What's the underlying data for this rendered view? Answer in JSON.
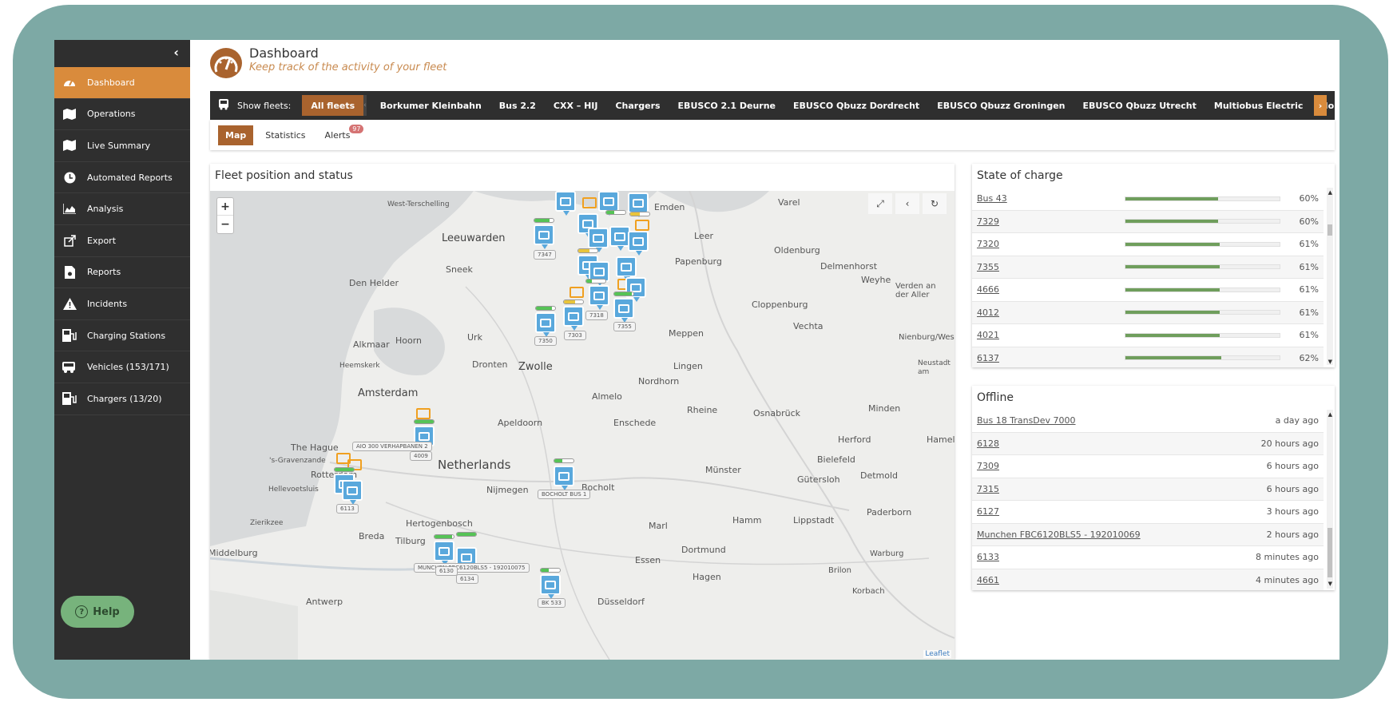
{
  "sidebar": {
    "items": [
      {
        "label": "Dashboard",
        "icon": "speedometer-icon"
      },
      {
        "label": "Operations",
        "icon": "map-icon"
      },
      {
        "label": "Live Summary",
        "icon": "map-icon"
      },
      {
        "label": "Automated Reports",
        "icon": "clock-icon"
      },
      {
        "label": "Analysis",
        "icon": "area-chart-icon"
      },
      {
        "label": "Export",
        "icon": "export-icon"
      },
      {
        "label": "Reports",
        "icon": "report-file-icon"
      },
      {
        "label": "Incidents",
        "icon": "warning-icon"
      },
      {
        "label": "Charging Stations",
        "icon": "charging-station-icon"
      },
      {
        "label": "Vehicles (153/171)",
        "icon": "bus-icon"
      },
      {
        "label": "Chargers (13/20)",
        "icon": "charger-icon"
      }
    ],
    "help_label": "Help"
  },
  "header": {
    "title": "Dashboard",
    "subtitle": "Keep track of the activity of your fleet"
  },
  "fleets": {
    "show_label": "Show fleets:",
    "items": [
      "All fleets",
      "Borkumer Kleinbahn",
      "Bus 2.2",
      "CXX – HIJ",
      "Chargers",
      "EBUSCO 2.1 Deurne",
      "EBUSCO Qbuzz Dordrecht",
      "EBUSCO Qbuzz Groningen",
      "EBUSCO Qbuzz Utrecht",
      "Multiobus Electric",
      "Norgesbuss Norway"
    ]
  },
  "tabs": {
    "map": "Map",
    "statistics": "Statistics",
    "alerts": "Alerts",
    "alerts_count": "97"
  },
  "map_panel": {
    "title": "Fleet position and status",
    "zoom_in": "+",
    "zoom_out": "−",
    "attribution": "Leaflet",
    "cities": [
      "West-Terschelling",
      "Leeuwarden",
      "Emden",
      "Varel",
      "Leer",
      "Oldenburg",
      "Sneek",
      "Papenburg",
      "Delmenhorst",
      "Den Helder",
      "Weyhe",
      "Verden an der Aller",
      "Cloppenburg",
      "Vechta",
      "Meppen",
      "Urk",
      "Alkmaar",
      "Hoorn",
      "Nienburg/Weser",
      "Heemskerk",
      "Dronten",
      "Zwolle",
      "Lingen",
      "Neustadt am Rübenberge",
      "Amsterdam",
      "Nordhorn",
      "Almelo",
      "Rheine",
      "Osnabrück",
      "Minden",
      "Apeldoorn",
      "Enschede",
      "The Hague",
      "Herford",
      "Hameln",
      "'s-Gravenzande",
      "Netherlands",
      "Bielefeld",
      "Rotterdam",
      "Münster",
      "Gütersloh",
      "Detmold",
      "Hellevoetsluis",
      "Nijmegen",
      "Bocholt",
      "Zierikzee",
      "Hertogenbosch",
      "Marl",
      "Hamm",
      "Lippstadt",
      "Paderborn",
      "Breda",
      "Tilburg",
      "Middelburg",
      "Dortmund",
      "Warburg",
      "Essen",
      "Hagen",
      "Brilon",
      "Korbach",
      "Antwerp",
      "Düsseldorf"
    ],
    "markers": [
      "7347",
      "7350",
      "7303",
      "7318",
      "7355",
      "4009",
      "6113",
      "BOCHOLT BUS 1",
      "AIO 300 VERHAPBANEN 2",
      "6130",
      "6134",
      "MUNCHEN FBC6120BLS5 - 192010075",
      "BK 533"
    ]
  },
  "state_of_charge": {
    "title": "State of charge",
    "rows": [
      {
        "name": "Bus 43",
        "pct": "60%",
        "value": 0.6
      },
      {
        "name": "7329",
        "pct": "60%",
        "value": 0.6
      },
      {
        "name": "7320",
        "pct": "61%",
        "value": 0.61
      },
      {
        "name": "7355",
        "pct": "61%",
        "value": 0.61
      },
      {
        "name": "4666",
        "pct": "61%",
        "value": 0.61
      },
      {
        "name": "4012",
        "pct": "61%",
        "value": 0.61
      },
      {
        "name": "4021",
        "pct": "61%",
        "value": 0.61
      },
      {
        "name": "6137",
        "pct": "62%",
        "value": 0.62
      }
    ]
  },
  "offline": {
    "title": "Offline",
    "rows": [
      {
        "name": "Bus 18 TransDev 7000",
        "time": "a day ago"
      },
      {
        "name": "6128",
        "time": "20 hours ago"
      },
      {
        "name": "7309",
        "time": "6 hours ago"
      },
      {
        "name": "7315",
        "time": "6 hours ago"
      },
      {
        "name": "6127",
        "time": "3 hours ago"
      },
      {
        "name": "Munchen FBC6120BLS5 - 192010069",
        "time": "2 hours ago"
      },
      {
        "name": "6133",
        "time": "8 minutes ago"
      },
      {
        "name": "4661",
        "time": "4 minutes ago"
      }
    ]
  },
  "colors": {
    "accent": "#d98b3c",
    "accent_dark": "#a9632e",
    "sidebar_bg": "#2f2f2f",
    "soc_bar": "#6f9e5c",
    "marker": "#59a8dc",
    "frame": "#7da9a5"
  }
}
